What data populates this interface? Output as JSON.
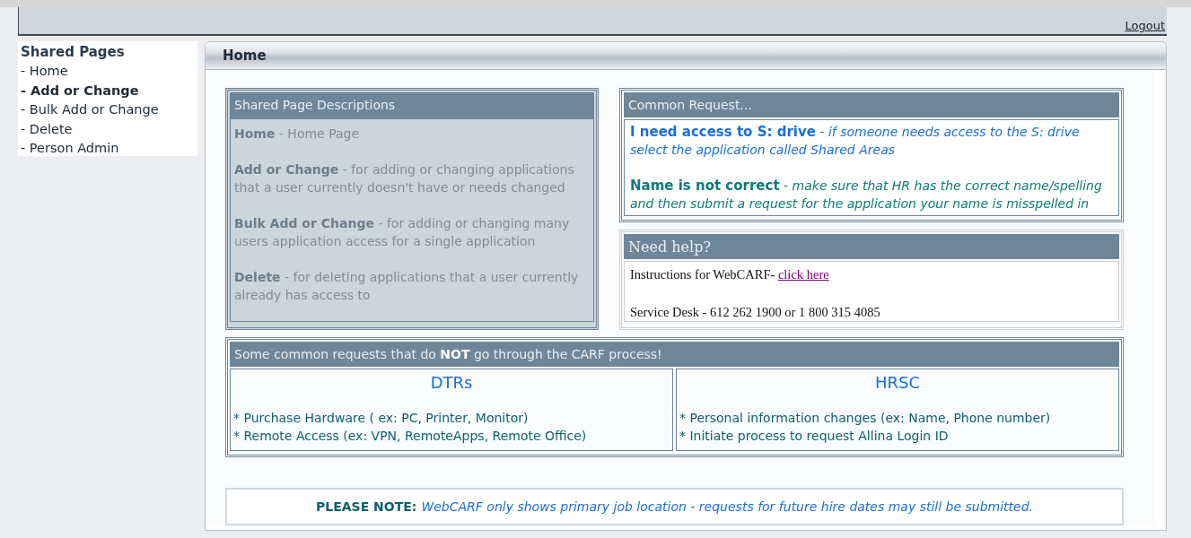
{
  "top_bar": {
    "logout": "Logout"
  },
  "sidebar": {
    "title": "Shared Pages",
    "items": [
      {
        "label": "- Home",
        "selected": false
      },
      {
        "label": "- Add or Change",
        "selected": true
      },
      {
        "label": "- Bulk Add or Change",
        "selected": false
      },
      {
        "label": "- Delete",
        "selected": false
      },
      {
        "label": "- Person Admin",
        "selected": false
      }
    ]
  },
  "panel": {
    "title": "Home"
  },
  "descriptions": {
    "title": "Shared Page Descriptions",
    "items": [
      "**Home** - Home Page",
      "**Add or Change** - for adding or changing applications that a user currently doesn't have or needs changed",
      "**Bulk Add or Change** - for adding or changing many users application access for a single application",
      "**Delete** - for deleting applications that a user currently already has access to"
    ]
  },
  "common_requests": {
    "title": "Common Request...",
    "items": [
      {
        "heading": "I need access to S: drive",
        "text": "- *if someone needs access to the S: drive select the application called Shared Areas*",
        "color": "#1a6fd6"
      },
      {
        "heading": "Name is not correct",
        "text": "- *make sure that HR has the correct name/spelling and then submit a request for the application your name is misspelled in*",
        "color": "#0f7a78"
      }
    ]
  },
  "help": {
    "title": "Need help?",
    "instructions": "Instructions for WebCARF- ",
    "link": "click here",
    "service_desk": "Service Desk - 612 262 1900 or 1 800 315 4085"
  },
  "other_requests": {
    "title": "Some common requests that do **NOT** go through the CARF process!",
    "columns": [
      {
        "title": "DTRs",
        "lines": [
          "* Purchase Hardware ( ex: PC, Printer, Monitor)",
          "* Remote Access (ex: VPN, RemoteApps, Remote Office)"
        ]
      },
      {
        "title": "HRSC",
        "lines": [
          "* Personal information changes (ex: Name, Phone number)",
          "* Initiate process to request Allina Login ID"
        ]
      }
    ]
  },
  "note": {
    "label": "PLEASE NOTE:",
    "text": "WebCARF only shows primary job location - requests for future hire dates may still be submitted."
  }
}
